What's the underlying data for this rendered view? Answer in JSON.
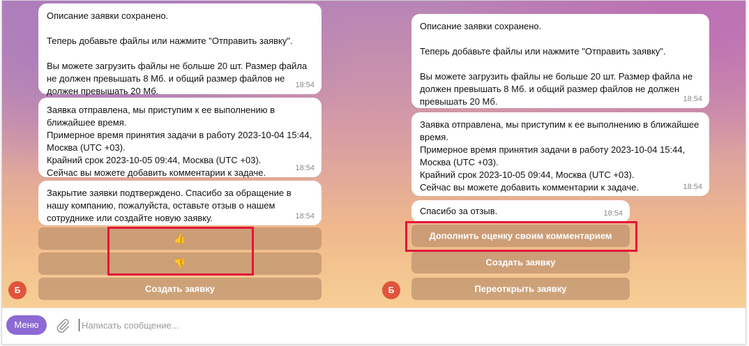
{
  "left_chat": {
    "messages": [
      {
        "text": "Описание заявки сохранено.\n\nТеперь добавьте файлы или нажмите \"Отправить заявку\".\n\nВы можете загрузить файлы не больше 20 шт. Размер файла не должен превышать 8 Мб. и общий размер файлов не должен превышать 20 Мб.",
        "time": "18:54"
      },
      {
        "text": "Заявка отправлена, мы приступим к ее выполнению в ближайшее время.\nПримерное время принятия задачи в работу 2023-10-04 15:44, Москва (UTC +03).\nКрайний срок 2023-10-05 09:44, Москва (UTC +03).\nСейчас вы можете добавить комментарии к задаче.",
        "time": "18:54"
      },
      {
        "text": "Закрытие заявки подтверждено. Спасибо за обращение в нашу компанию, пожалуйста, оставьте отзыв о нашем сотруднике или создайте новую заявку.",
        "time": "18:54"
      }
    ],
    "buttons": {
      "thumbs_up": "👍",
      "thumbs_down": "👎",
      "create": "Создать заявку"
    },
    "avatar": "Б"
  },
  "right_chat": {
    "messages": [
      {
        "text": "Описание заявки сохранено.\n\nТеперь добавьте файлы или нажмите \"Отправить заявку\".\n\nВы можете загрузить файлы не больше 20 шт. Размер файла не должен превышать 8 Мб. и общий размер файлов не должен превышать 20 Мб.",
        "time": "18:54"
      },
      {
        "text": "Заявка отправлена, мы приступим к ее выполнению в ближайшее время.\nПримерное время принятия задачи в работу 2023-10-04 15:44, Москва (UTC +03).\nКрайний срок 2023-10-05 09:44, Москва (UTC +03).\nСейчас вы можете добавить комментарии к задаче.",
        "time": "18:54"
      },
      {
        "text": "Спасибо за отзыв.",
        "time": "18:54"
      }
    ],
    "buttons": {
      "add_comment": "Дополнить оценку своим комментарием",
      "create": "Создать заявку",
      "reopen": "Переоткрыть заявку"
    },
    "avatar": "Б"
  },
  "composer": {
    "menu_label": "Меню",
    "placeholder": "Написать сообщение..."
  },
  "colors": {
    "highlight": "#e2163a",
    "menu": "#8d6ad4",
    "avatar": "#e0543c"
  }
}
